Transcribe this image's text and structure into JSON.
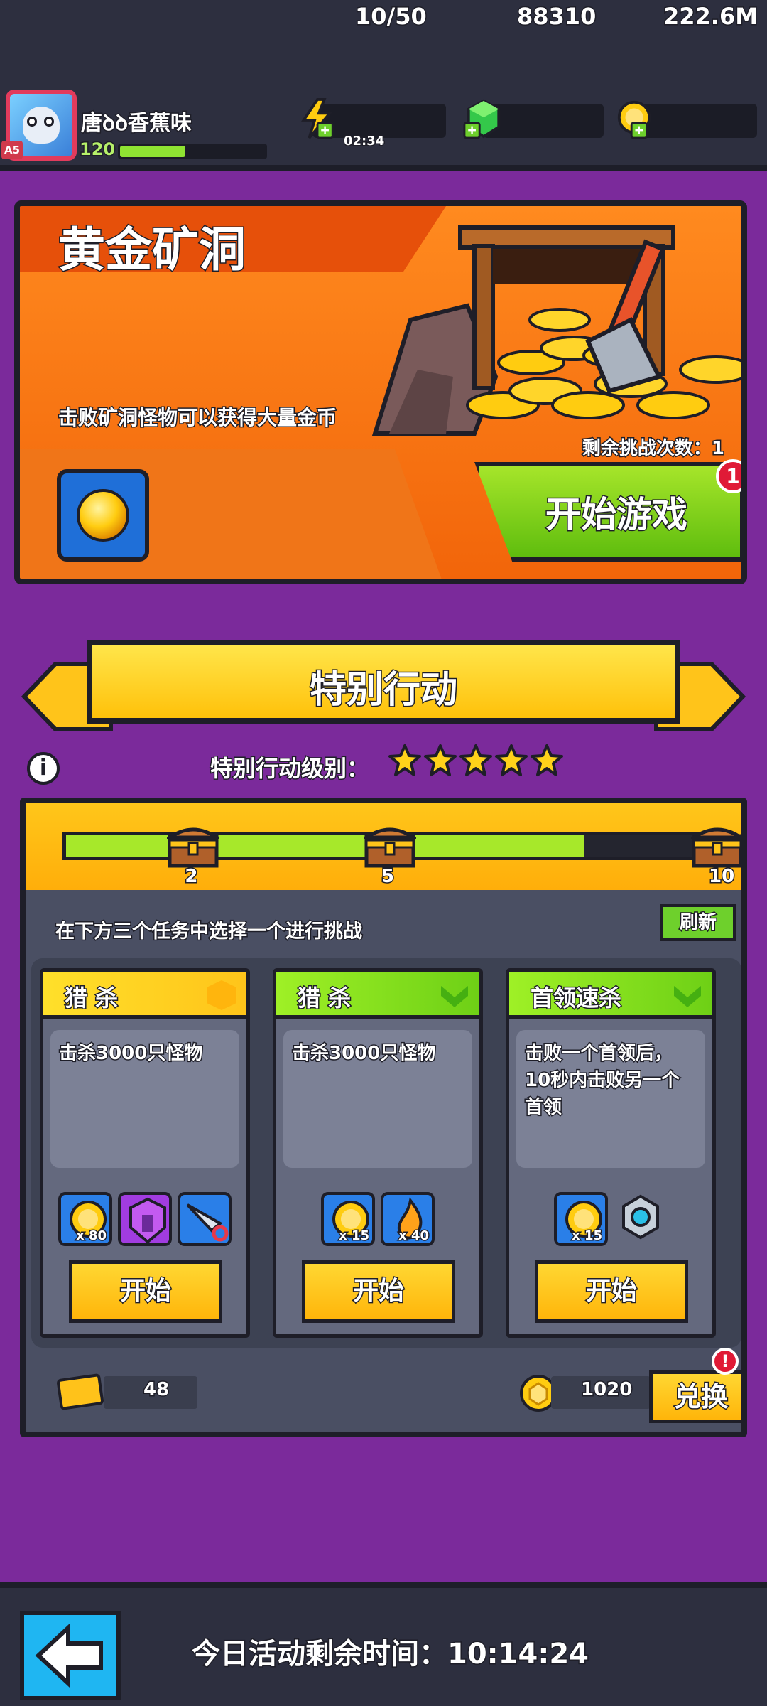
{
  "player": {
    "name": "唐ꝺꝺ香蕉味",
    "level": "120",
    "avatar_badge": "A5",
    "xp_progress": 0.45
  },
  "resources": {
    "energy": "10/50",
    "energy_timer": "02:34",
    "gems": "88310",
    "gold": "222.6M"
  },
  "gold_mine": {
    "title": "黄金矿洞",
    "description": "击败矿洞怪物可以获得大量金币",
    "remaining_label": "剩余挑战次数：1",
    "start_button": "开始游戏",
    "start_badge": "1"
  },
  "special_action": {
    "title": "特别行动",
    "level_label": "特别行动级别：",
    "stars": 5,
    "info_icon": "i",
    "progress": {
      "fill_fraction": 0.8,
      "milestones": [
        {
          "value": "2",
          "at": 0.2
        },
        {
          "value": "5",
          "at": 0.5
        },
        {
          "value": "10",
          "at": 1.0
        }
      ]
    },
    "instruction": "在下方三个任务中选择一个进行挑战",
    "refresh_button": "刷新",
    "missions": [
      {
        "type": "猎 杀",
        "head_color": "yellow",
        "description": "击杀3000只怪物",
        "rewards": [
          {
            "icon": "gold-coin-icon",
            "count": "x 80",
            "bg": "blue"
          },
          {
            "icon": "shield-upgrade-icon",
            "count": "",
            "bg": "purple"
          },
          {
            "icon": "kunai-weapon-icon",
            "count": "",
            "bg": "blue"
          }
        ],
        "start_button": "开始"
      },
      {
        "type": "猎 杀",
        "head_color": "green",
        "description": "击杀3000只怪物",
        "rewards": [
          {
            "icon": "gold-coin-icon",
            "count": "x 15",
            "bg": "blue"
          },
          {
            "icon": "fire-essence-icon",
            "count": "x 40",
            "bg": "blue"
          }
        ],
        "start_button": "开始"
      },
      {
        "type": "首领速杀",
        "head_color": "green",
        "description": "击败一个首领后，10秒内击败另一个首领",
        "rewards": [
          {
            "icon": "gold-coin-icon",
            "count": "x 15",
            "bg": "blue"
          },
          {
            "icon": "gear-part-icon",
            "count": "",
            "bg": "none"
          }
        ],
        "start_button": "开始"
      }
    ],
    "tickets": "48",
    "tokens": "1020",
    "exchange_button": "兑换",
    "exchange_alert": "!"
  },
  "footer": {
    "countdown": "今日活动剩余时间：10:14:24"
  }
}
